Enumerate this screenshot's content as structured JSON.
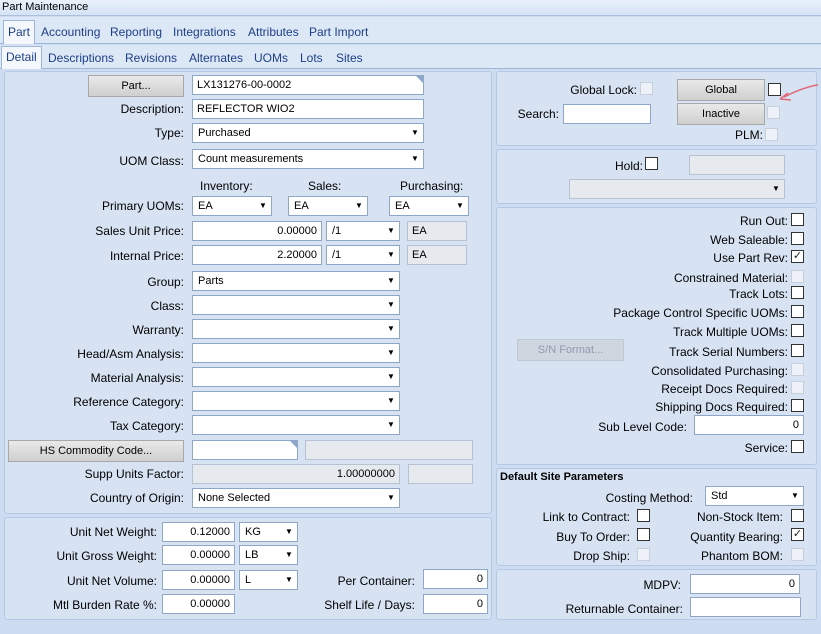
{
  "window": {
    "title": "Part Maintenance"
  },
  "tabs": [
    "Part",
    "Accounting",
    "Reporting",
    "Integrations",
    "Attributes",
    "Part Import"
  ],
  "subtabs": [
    "Detail",
    "Descriptions",
    "Revisions",
    "Alternates",
    "UOMs",
    "Lots",
    "Sites"
  ],
  "left": {
    "part_button": "Part...",
    "part_value": "LX131276-00-0002",
    "description_label": "Description:",
    "description_value": "REFLECTOR WIO2",
    "type_label": "Type:",
    "type_value": "Purchased",
    "uom_class_label": "UOM Class:",
    "uom_class_value": "Count measurements",
    "inventory_header": "Inventory:",
    "sales_header": "Sales:",
    "purchasing_header": "Purchasing:",
    "primary_uoms_label": "Primary UOMs:",
    "inventory_uom": "EA",
    "sales_uom": "EA",
    "purchasing_uom": "EA",
    "sales_unit_price_label": "Sales Unit Price:",
    "sales_unit_price": "0.00000",
    "sales_price_per": "/1",
    "sales_price_uom": "EA",
    "internal_price_label": "Internal Price:",
    "internal_price": "2.20000",
    "internal_price_per": "/1",
    "internal_price_uom": "EA",
    "group_label": "Group:",
    "group_value": "Parts",
    "class_label": "Class:",
    "warranty_label": "Warranty:",
    "head_asm_label": "Head/Asm Analysis:",
    "material_analysis_label": "Material Analysis:",
    "reference_category_label": "Reference Category:",
    "tax_category_label": "Tax Category:",
    "hs_button": "HS Commodity Code...",
    "supp_units_label": "Supp Units Factor:",
    "supp_units_value": "1.00000000",
    "country_label": "Country of Origin:",
    "country_value": "None Selected"
  },
  "weights": {
    "net_weight_label": "Unit Net Weight:",
    "net_weight": "0.12000",
    "net_weight_uom": "KG",
    "gross_weight_label": "Unit Gross Weight:",
    "gross_weight": "0.00000",
    "gross_weight_uom": "LB",
    "net_volume_label": "Unit Net Volume:",
    "net_volume": "0.00000",
    "net_volume_uom": "L",
    "burden_label": "Mtl Burden Rate %:",
    "burden": "0.00000",
    "per_container_label": "Per Container:",
    "per_container": "0",
    "shelf_life_label": "Shelf Life / Days:",
    "shelf_life": "0"
  },
  "right_top": {
    "global_lock_label": "Global Lock:",
    "global_button": "Global",
    "search_label": "Search:",
    "inactive_button": "Inactive",
    "plm_label": "PLM:",
    "hold_label": "Hold:"
  },
  "flags": {
    "sn_format_button": "S/N Format...",
    "items": [
      {
        "label": "Run Out:",
        "checked": false,
        "disabled": false
      },
      {
        "label": "Web Saleable:",
        "checked": false,
        "disabled": false
      },
      {
        "label": "Use Part Rev:",
        "checked": true,
        "disabled": false
      },
      {
        "label": "Constrained Material:",
        "checked": false,
        "disabled": true
      },
      {
        "label": "Track Lots:",
        "checked": false,
        "disabled": false
      },
      {
        "label": "Package Control Specific UOMs:",
        "checked": false,
        "disabled": false
      },
      {
        "label": "Track Multiple UOMs:",
        "checked": false,
        "disabled": false
      },
      {
        "label": "Track Serial Numbers:",
        "checked": false,
        "disabled": false
      },
      {
        "label": "Consolidated Purchasing:",
        "checked": false,
        "disabled": true
      },
      {
        "label": "Receipt Docs Required:",
        "checked": false,
        "disabled": true
      },
      {
        "label": "Shipping Docs Required:",
        "checked": false,
        "disabled": false
      }
    ],
    "sub_level_label": "Sub Level Code:",
    "sub_level_value": "0",
    "service_label": "Service:"
  },
  "site_params": {
    "title": "Default Site Parameters",
    "costing_label": "Costing Method:",
    "costing_value": "Std",
    "link_contract_label": "Link to Contract:",
    "non_stock_label": "Non-Stock Item:",
    "buy_to_order_label": "Buy To Order:",
    "qty_bearing_label": "Quantity Bearing:",
    "drop_ship_label": "Drop Ship:",
    "phantom_bom_label": "Phantom BOM:"
  },
  "bottom_right": {
    "mdpv_label": "MDPV:",
    "mdpv_value": "0",
    "returnable_label": "Returnable Container:"
  },
  "icons": {
    "dropdown": "triangle-down-icon",
    "annotation": "red-arrow-annotation"
  },
  "colors": {
    "link_blue": "#1c3f86",
    "panel": "#d7e3f3",
    "annotation": "#e06a78"
  }
}
